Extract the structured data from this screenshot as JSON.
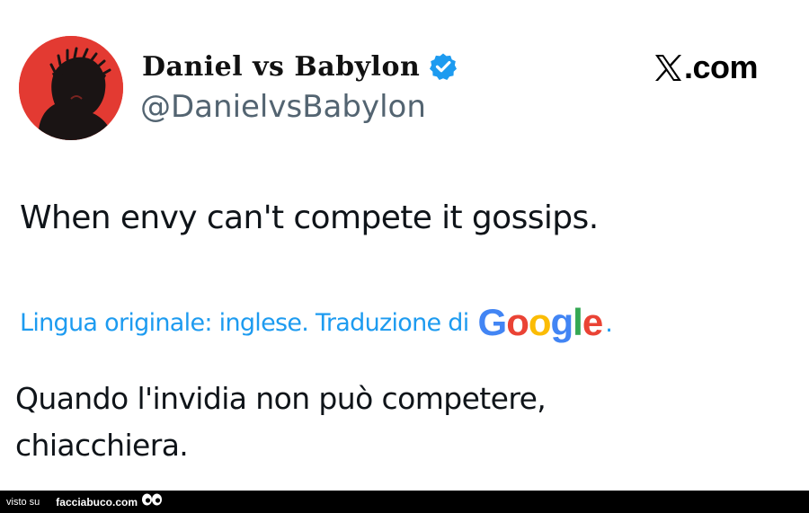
{
  "author": {
    "display_name": "Daniel vs Babylon",
    "handle": "@DanielvsBabylon",
    "avatar_icon": "silhouette-crown-of-thorns-icon",
    "avatar_color": "#e33a32",
    "verified_icon": "verified-badge-icon",
    "verified_color": "#1d9bf0"
  },
  "brand": {
    "icon": "x-logo-icon",
    "text": ".com"
  },
  "tweet": {
    "text": "When envy can't compete it gossips."
  },
  "translation": {
    "label": "Lingua originale: inglese. Traduzione di",
    "provider": "Google",
    "suffix": ".",
    "link_color": "#1d9bf0",
    "text": "Quando l'invidia non può competere, chiacchiera."
  },
  "footer": {
    "prefix": "visto su",
    "site": "facciabuco.com",
    "icon": "eyes-icon"
  }
}
